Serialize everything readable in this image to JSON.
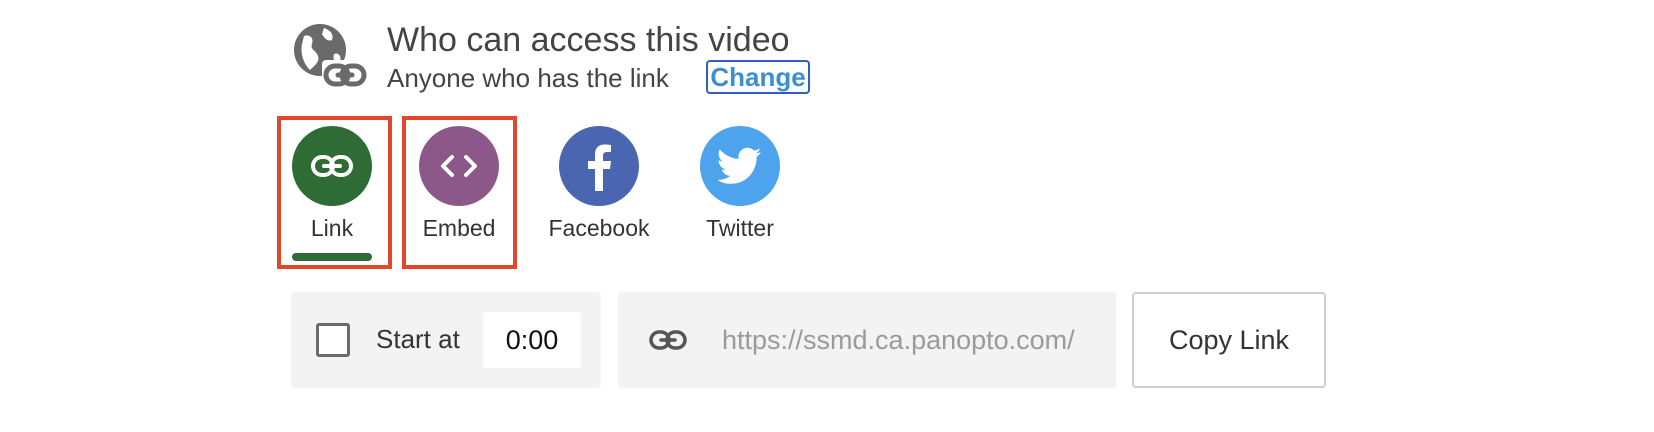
{
  "access": {
    "icon": "globe-link-icon",
    "title": "Who can access this video",
    "subtitle": "Anyone who has the link",
    "change_label": "Change",
    "change_color": "#2f5fc0"
  },
  "share": {
    "options": [
      {
        "label": "Link",
        "icon": "link-icon",
        "color": "#2e6b35",
        "active": true,
        "highlighted": true
      },
      {
        "label": "Embed",
        "icon": "code-icon",
        "color": "#8b5889",
        "active": false,
        "highlighted": true
      },
      {
        "label": "Facebook",
        "icon": "facebook-icon",
        "color": "#4a66b0",
        "active": false,
        "highlighted": false
      },
      {
        "label": "Twitter",
        "icon": "twitter-icon",
        "color": "#4da3ec",
        "active": false,
        "highlighted": false
      }
    ],
    "highlight_color": "#e5452a"
  },
  "controls": {
    "start_at_label": "Start at",
    "start_at_checked": false,
    "start_time": "0:00",
    "url": "https://ssmd.ca.panopto.com/",
    "url_icon": "link-icon",
    "copy_label": "Copy Link"
  }
}
